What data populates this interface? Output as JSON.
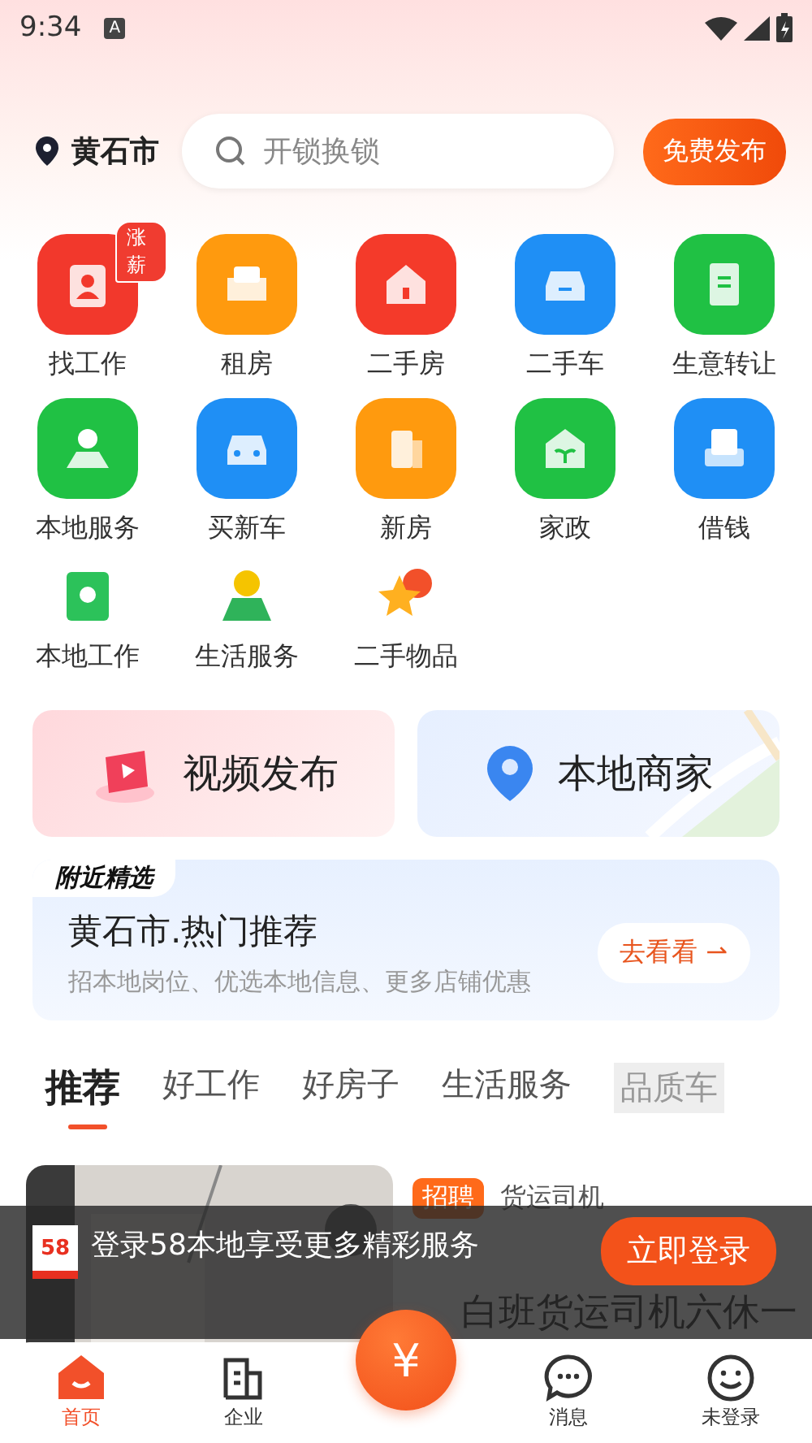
{
  "status_bar": {
    "time": "9:34",
    "notification": "A"
  },
  "header": {
    "city": "黄石市",
    "search": {
      "placeholder": "开锁换锁"
    },
    "publish_button": "免费发布"
  },
  "categories": [
    {
      "label": "找工作",
      "kind": "large",
      "color": "#f2382c",
      "badge": "涨薪"
    },
    {
      "label": "租房",
      "kind": "large",
      "color": "#ff9a0e"
    },
    {
      "label": "二手房",
      "kind": "large",
      "color": "#f43a2a"
    },
    {
      "label": "二手车",
      "kind": "large",
      "color": "#1f8ff5"
    },
    {
      "label": "生意转让",
      "kind": "large",
      "color": "#20c144"
    },
    {
      "label": "本地服务",
      "kind": "large",
      "color": "#20c144"
    },
    {
      "label": "买新车",
      "kind": "large",
      "color": "#1f8ff5"
    },
    {
      "label": "新房",
      "kind": "large",
      "color": "#ff9a0e"
    },
    {
      "label": "家政",
      "kind": "large",
      "color": "#20c144"
    },
    {
      "label": "借钱",
      "kind": "large",
      "color": "#1f8ff5"
    },
    {
      "label": "本地工作",
      "kind": "small",
      "color": "#2cc25a"
    },
    {
      "label": "生活服务",
      "kind": "small",
      "color": "#2fb35a"
    },
    {
      "label": "二手物品",
      "kind": "small",
      "color": "#ffb020"
    }
  ],
  "promo_cards": [
    {
      "label": "视频发布",
      "kind": "video"
    },
    {
      "label": "本地商家",
      "kind": "map"
    }
  ],
  "nearby": {
    "tag": "附近精选",
    "title": "黄石市.热门推荐",
    "subtitle": "招本地岗位、优选本地信息、更多店铺优惠",
    "button": "去看看",
    "button_arrow": "⇀"
  },
  "tabs": [
    {
      "label": "推荐",
      "selected": true
    },
    {
      "label": "好工作",
      "selected": false
    },
    {
      "label": "好房子",
      "selected": false
    },
    {
      "label": "生活服务",
      "selected": false
    },
    {
      "label": "品质车",
      "selected": false
    }
  ],
  "feed_card": {
    "tag": "招聘",
    "category": "货运司机",
    "title": "白班货运司机六休一"
  },
  "login_banner": {
    "logo": "58",
    "text": "登录58本地享受更多精彩服务",
    "button": "立即登录"
  },
  "bottom_nav": {
    "center": "¥",
    "items": [
      {
        "label": "首页",
        "selected": true,
        "kind": "home"
      },
      {
        "label": "企业",
        "selected": false,
        "kind": "building"
      },
      {
        "label": "消息",
        "selected": false,
        "kind": "chat"
      },
      {
        "label": "未登录",
        "selected": false,
        "kind": "face"
      }
    ]
  }
}
